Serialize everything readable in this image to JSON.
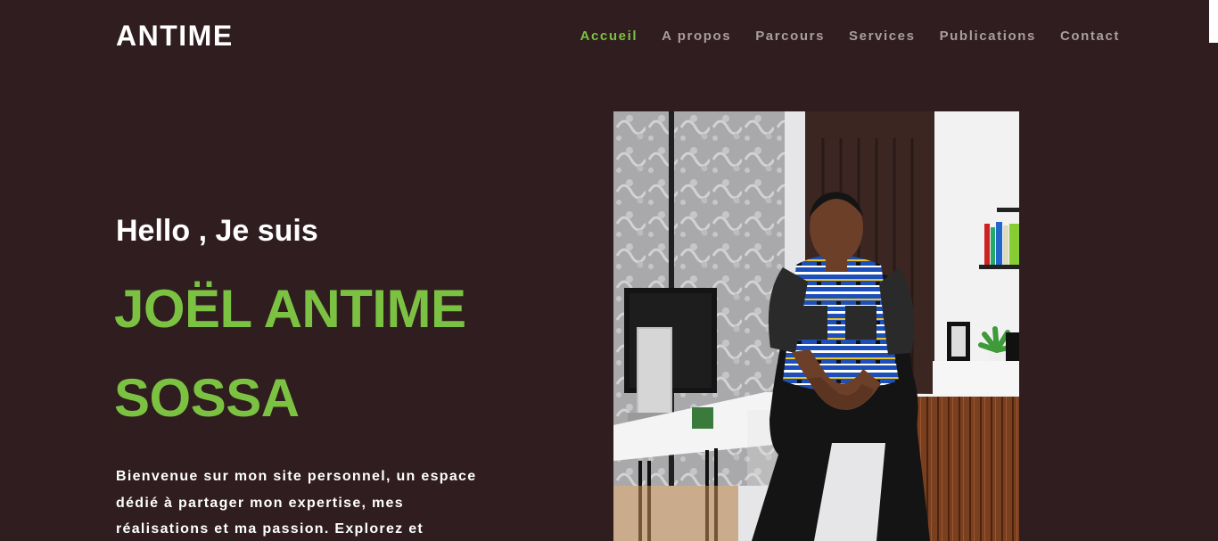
{
  "header": {
    "brand": "ANTIME",
    "nav": [
      {
        "label": "Accueil",
        "active": true
      },
      {
        "label": "A propos",
        "active": false
      },
      {
        "label": "Parcours",
        "active": false
      },
      {
        "label": "Services",
        "active": false
      },
      {
        "label": "Publications",
        "active": false
      },
      {
        "label": "Contact",
        "active": false
      }
    ]
  },
  "hero": {
    "greeting": "Hello , Je suis",
    "name_line1": "JOËL ANTIME",
    "name_line2": "SOSSA",
    "intro": "Bienvenue sur mon site personnel, un espace dédié à partager mon expertise, mes réalisations et ma passion. Explorez et"
  },
  "colors": {
    "background": "#2f1d1f",
    "accent": "#7cc242",
    "nav_text": "#a89e9f",
    "text": "#ffffff"
  }
}
